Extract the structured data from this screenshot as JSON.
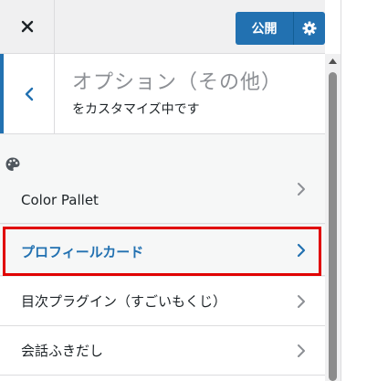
{
  "header": {
    "publish_label": "公開",
    "close_icon": "close-icon",
    "settings_icon": "gear-icon"
  },
  "section": {
    "title": "オプション（その他）",
    "subtitle": "をカスタマイズ中です",
    "back_icon": "chevron-left-icon"
  },
  "menu": {
    "palette": {
      "label": "Color Pallet",
      "icon": "palette-icon"
    },
    "items": [
      {
        "label": "プロフィールカード",
        "highlighted": true
      },
      {
        "label": "目次プラグイン（すごいもくじ）",
        "highlighted": false
      },
      {
        "label": "会話ふきだし",
        "highlighted": false
      }
    ]
  },
  "colors": {
    "accent": "#2271b1",
    "highlight_border": "#e00000",
    "text": "#1d2327",
    "muted": "#8c8f94"
  }
}
